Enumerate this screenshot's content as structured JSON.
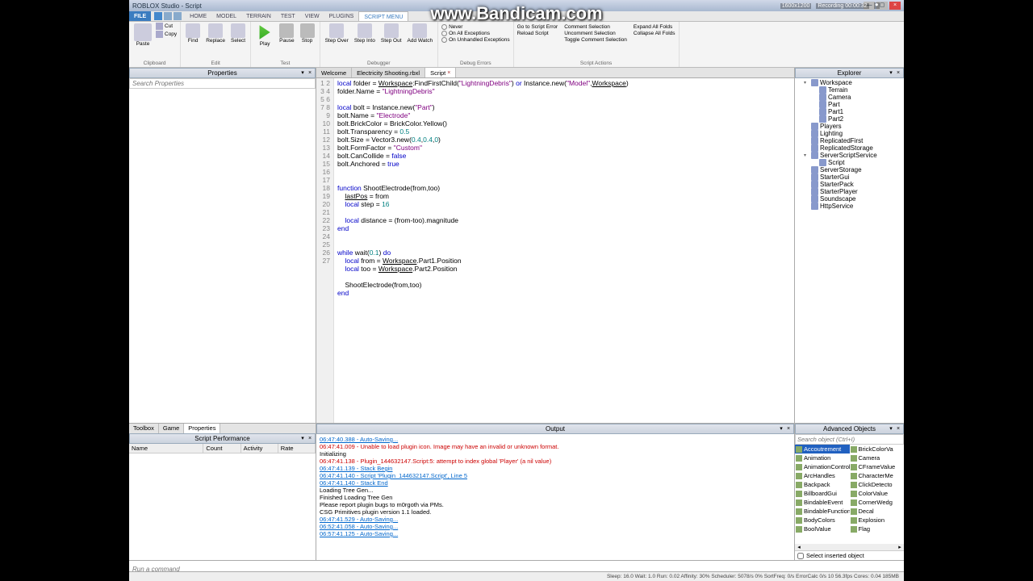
{
  "title": "ROBLOX Studio - Script",
  "watermark": "www.Bandicam.com",
  "recording": {
    "res": "1600x1200",
    "time": "Recording   00:00:32"
  },
  "ribbonTabs": [
    "FILE",
    "HOME",
    "MODEL",
    "TERRAIN",
    "TEST",
    "VIEW",
    "PLUGINS",
    "SCRIPT MENU"
  ],
  "activeTab": 7,
  "ribbon": {
    "clipboard": {
      "label": "Clipboard",
      "paste": "Paste",
      "cut": "Cut",
      "copy": "Copy"
    },
    "edit": {
      "label": "Edit",
      "find": "Find",
      "replace": "Replace",
      "select": "Select"
    },
    "test": {
      "label": "Test",
      "play": "Play",
      "pause": "Pause",
      "stop": "Stop"
    },
    "debugger": {
      "label": "Debugger",
      "over": "Step\nOver",
      "into": "Step\nInto",
      "out": "Step\nOut",
      "add": "Add\nWatch"
    },
    "debugerr": {
      "label": "Debug Errors",
      "never": "Never",
      "all": "On All Exceptions",
      "unh": "On Unhandled Exceptions"
    },
    "scriptact": {
      "label": "Script Actions",
      "goerr": "Go to Script Error",
      "reload": "Reload Script",
      "comsel": "Comment Selection",
      "uncom": "Uncomment Selection",
      "toggle": "Toggle Comment Selection",
      "expand": "Expand All Folds",
      "collapse": "Collapse All Folds"
    }
  },
  "panels": {
    "properties": "Properties",
    "explorer": "Explorer",
    "scriptPerf": "Script Performance",
    "output": "Output",
    "advObj": "Advanced Objects"
  },
  "propSearch": "Search Properties",
  "docTabs": [
    {
      "label": "Welcome"
    },
    {
      "label": "Electricity Shooting.rbxl"
    },
    {
      "label": "Script",
      "active": true,
      "close": true
    }
  ],
  "code": {
    "lines": 27,
    "l1a": "local",
    "l1b": " folder = ",
    "l1c": "Workspace",
    "l1d": ":FindFirstChild(",
    "l1e": "\"LightningDebris\"",
    "l1f": ") ",
    "l1g": "or",
    "l1h": " Instance.new(",
    "l1i": "\"Model\"",
    "l1j": ",",
    "l1k": "Workspace",
    "l1l": ")",
    "l2a": "folder.Name = ",
    "l2b": "\"LightningDebris\"",
    "l4a": "local",
    "l4b": " bolt = Instance.new(",
    "l4c": "\"Part\"",
    "l4d": ")",
    "l5a": "bolt.Name = ",
    "l5b": "\"Electrode\"",
    "l6a": "bolt.BrickColor = BrickColor.Yellow()",
    "l7a": "bolt.Transparency = ",
    "l7b": "0.5",
    "l8a": "bolt.Size = Vector3.new(",
    "l8b": "0.4",
    "l8c": ",",
    "l8d": "0.4",
    "l8e": ",",
    "l8f": "0",
    "l8g": ")",
    "l9a": "bolt.FormFactor = ",
    "l9b": "\"Custom\"",
    "l10a": "bolt.CanCollide = ",
    "l10b": "false",
    "l11a": "bolt.Anchored = ",
    "l11b": "true",
    "l14a": "function",
    "l14b": " ShootElectrode(from,too)",
    "l15a": "lastPos",
    "l15b": " = from",
    "l16a": "local",
    "l16b": " step = ",
    "l16c": "16",
    "l18a": "local",
    "l18b": " distance = (from-too).magnitude",
    "l19": "end",
    "l22a": "while",
    "l22b": " wait(",
    "l22c": "0.1",
    "l22d": ") ",
    "l22e": "do",
    "l23a": "local",
    "l23b": " from = ",
    "l23c": "Workspace",
    "l23d": ".Part1.Position",
    "l24a": "local",
    "l24b": " too = ",
    "l24c": "Workspace",
    "l24d": ".Part2.Position",
    "l26": "ShootElectrode(from,too)",
    "l27": "end"
  },
  "explorer": [
    {
      "l": "Workspace",
      "i": 1,
      "a": "▾"
    },
    {
      "l": "Terrain",
      "i": 2
    },
    {
      "l": "Camera",
      "i": 2
    },
    {
      "l": "Part",
      "i": 2
    },
    {
      "l": "Part1",
      "i": 2
    },
    {
      "l": "Part2",
      "i": 2
    },
    {
      "l": "Players",
      "i": 1
    },
    {
      "l": "Lighting",
      "i": 1
    },
    {
      "l": "ReplicatedFirst",
      "i": 1
    },
    {
      "l": "ReplicatedStorage",
      "i": 1
    },
    {
      "l": "ServerScriptService",
      "i": 1,
      "a": "▾"
    },
    {
      "l": "Script",
      "i": 2
    },
    {
      "l": "ServerStorage",
      "i": 1
    },
    {
      "l": "StarterGui",
      "i": 1
    },
    {
      "l": "StarterPack",
      "i": 1
    },
    {
      "l": "StarterPlayer",
      "i": 1
    },
    {
      "l": "Soundscape",
      "i": 1
    },
    {
      "l": "HttpService",
      "i": 1
    }
  ],
  "bottomTabs": [
    "Toolbox",
    "Game",
    "Properties"
  ],
  "perfCols": [
    "Name",
    "Count",
    "Activity",
    "Rate"
  ],
  "output": [
    {
      "t": "06:47:40.388 - Auto-Saving...",
      "c": "blue"
    },
    {
      "t": "06:47:41.009 - Unable to load plugin icon. Image may have an invalid or unknown format.",
      "c": "red"
    },
    {
      "t": "Initializing"
    },
    {
      "t": "06:47:41.138 - Plugin_144632147.Script:5: attempt to index global 'Player' (a nil value)",
      "c": "red"
    },
    {
      "t": "06:47:41.139 - Stack Begin",
      "c": "blue"
    },
    {
      "t": "06:47:41.140 - Script 'Plugin_144632147.Script', Line 5",
      "c": "blue"
    },
    {
      "t": "06:47:41.140 - Stack End",
      "c": "blue"
    },
    {
      "t": "Loading Tree Gen..."
    },
    {
      "t": "Finished Loading Tree Gen"
    },
    {
      "t": "Please report plugin bugs to m0rgoth via PMs."
    },
    {
      "t": "CSG Primitives plugin version 1.1 loaded."
    },
    {
      "t": "06:47:41.529 - Auto-Saving...",
      "c": "blue"
    },
    {
      "t": "06:52:41.058 - Auto-Saving...",
      "c": "blue"
    },
    {
      "t": "06:57:41.125 - Auto-Saving...",
      "c": "blue"
    }
  ],
  "advSearch": "Search object (Ctrl+I)",
  "advLeft": [
    "Accoutrement",
    "Animation",
    "AnimationController",
    "ArcHandles",
    "Backpack",
    "BillboardGui",
    "BindableEvent",
    "BindableFunction",
    "BodyColors",
    "BoolValue"
  ],
  "advRight": [
    "BrickColorVa",
    "Camera",
    "CFrameValue",
    "CharacterMe",
    "ClickDetecto",
    "ColorValue",
    "CornerWedg",
    "Decal",
    "Explosion",
    "Flag"
  ],
  "advFoot": "Select inserted object",
  "cmd": "Run a command",
  "status": "Sleep: 16.0 Wait: 1.0 Run: 0.02 Affinity: 30% Scheduler: 5078/s 0% SortFreq: 0/s ErrorCalc 0/s     10     56.3fps     Cores: 0.04     185MB"
}
